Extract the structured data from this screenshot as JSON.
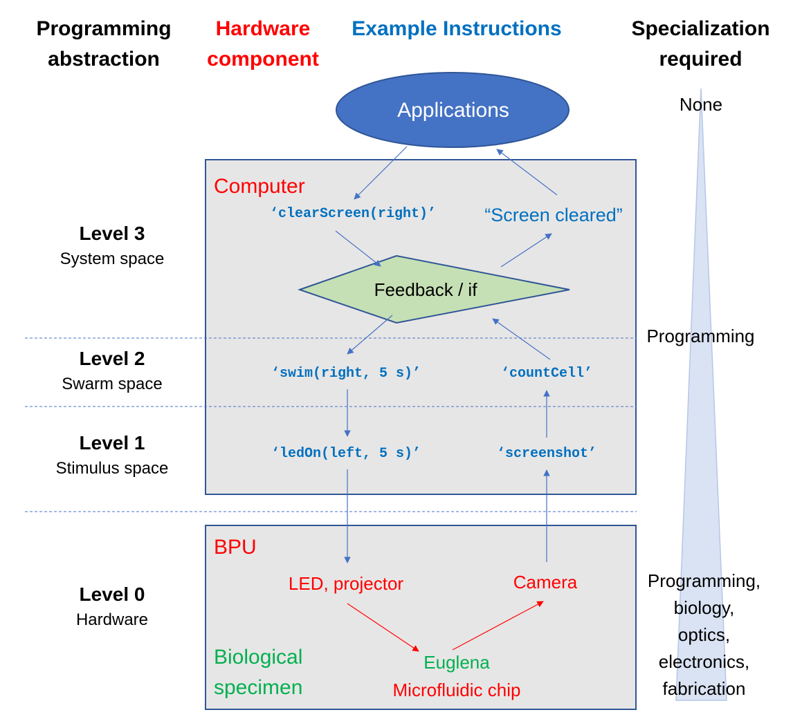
{
  "headers": {
    "programming_abstraction": [
      "Programming",
      "abstraction"
    ],
    "hardware_component": [
      "Hardware",
      "component"
    ],
    "example_instructions": "Example Instructions",
    "specialization_required": [
      "Specialization",
      "required"
    ]
  },
  "levels": [
    {
      "title": "Level 3",
      "subtitle": "System space"
    },
    {
      "title": "Level 2",
      "subtitle": "Swarm space"
    },
    {
      "title": "Level 1",
      "subtitle": "Stimulus space"
    },
    {
      "title": "Level 0",
      "subtitle": "Hardware"
    }
  ],
  "applications_label": "Applications",
  "computer_box": {
    "title": "Computer",
    "instructions": {
      "clear_screen": "‘clearScreen(right)’",
      "screen_cleared": "“Screen cleared”",
      "feedback": "Feedback / if",
      "swim": "‘swim(right, 5 s)’",
      "count_cell": "‘countCell’",
      "led_on": "‘ledOn(left, 5 s)’",
      "screenshot": "‘screenshot’"
    }
  },
  "bpu_box": {
    "title": "BPU",
    "led_projector": "LED, projector",
    "camera": "Camera",
    "biological_specimen": [
      "Biological",
      "specimen"
    ],
    "euglena": "Euglena",
    "microfluidic_chip": "Microfluidic chip"
  },
  "specialization": {
    "top": "None",
    "middle": "Programming",
    "bottom": [
      "Programming,",
      "biology,",
      "optics,",
      "electronics,",
      "fabrication"
    ]
  },
  "colors": {
    "box_fill": "#e7e6e6",
    "box_border": "#2f5597",
    "ellipse_fill": "#4472c4",
    "diamond_fill": "#c5e0b4",
    "arrow_blue": "#4472c4",
    "arrow_red": "#ff0000",
    "text_blue": "#0070c0",
    "text_red": "#ff0000",
    "text_green": "#00b050",
    "wedge_fill": "#dae3f3"
  }
}
